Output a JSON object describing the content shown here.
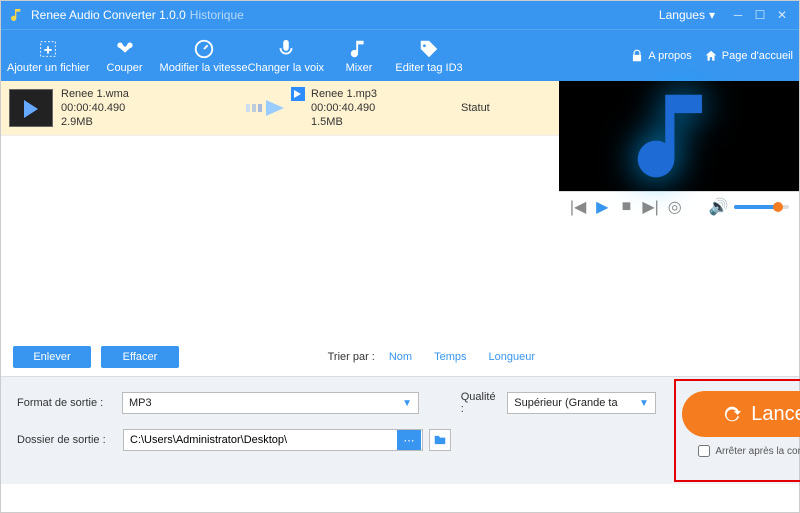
{
  "window": {
    "title": "Renee Audio Converter 1.0.0",
    "history": "Historique",
    "languages": "Langues"
  },
  "toolbar": {
    "add": "Ajouter un fichier",
    "cut": "Couper",
    "speed": "Modifier la vitesse",
    "voice": "Changer la voix",
    "mixer": "Mixer",
    "id3": "Editer tag ID3",
    "about": "A propos",
    "home": "Page d'accueil"
  },
  "row": {
    "src_name": "Renee 1.wma",
    "src_dur": "00:00:40.490",
    "src_size": "2.9MB",
    "dst_name": "Renee 1.mp3",
    "dst_dur": "00:00:40.490",
    "dst_size": "1.5MB",
    "status": "Statut"
  },
  "listfoot": {
    "remove": "Enlever",
    "clear": "Effacer",
    "sortby": "Trier par :",
    "s1": "Nom",
    "s2": "Temps",
    "s3": "Longueur"
  },
  "form": {
    "format_label": "Format de sortie :",
    "format_value": "MP3",
    "quality_label": "Qualité :",
    "quality_value": "Supérieur (Grande ta",
    "folder_label": "Dossier de sortie :",
    "folder_value": "C:\\Users\\Administrator\\Desktop\\"
  },
  "launch": {
    "button": "Lancer",
    "stop_after": "Arrêter après la conversion"
  }
}
